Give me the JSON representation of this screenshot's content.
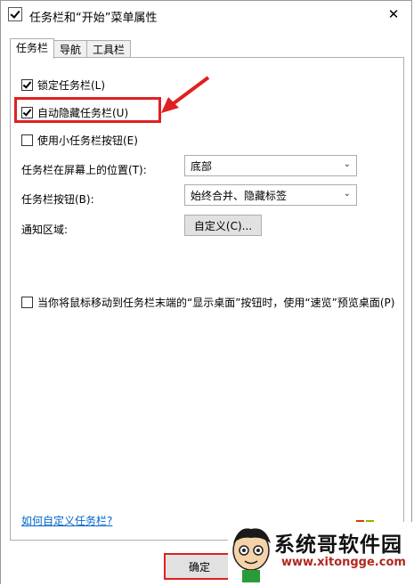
{
  "window": {
    "title": "任务栏和“开始”菜单属性",
    "close_glyph": "✕"
  },
  "tabs": [
    {
      "label": "任务栏",
      "active": true
    },
    {
      "label": "导航",
      "active": false
    },
    {
      "label": "工具栏",
      "active": false
    }
  ],
  "taskbar": {
    "lock_label": "锁定任务栏(L)",
    "lock_checked": true,
    "autohide_label": "自动隐藏任务栏(U)",
    "autohide_checked": true,
    "small_buttons_label": "使用小任务栏按钮(E)",
    "small_buttons_checked": false,
    "position_label": "任务栏在屏幕上的位置(T):",
    "position_value": "底部",
    "buttons_label": "任务栏按钮(B):",
    "buttons_value": "始终合并、隐藏标签",
    "notification_label": "通知区域:",
    "customize_button": "自定义(C)...",
    "peek_label": "当你将鼠标移动到任务栏末端的“显示桌面”按钮时，使用“速览”预览桌面(P)",
    "peek_checked": false,
    "help_link": "如何自定义任务栏?"
  },
  "footer": {
    "ok_label": "确定"
  },
  "watermark": {
    "site_name": "系统哥软件园",
    "url": "www.xitongge.com"
  },
  "colors": {
    "highlight": "#e02020",
    "link": "#0066cc"
  }
}
